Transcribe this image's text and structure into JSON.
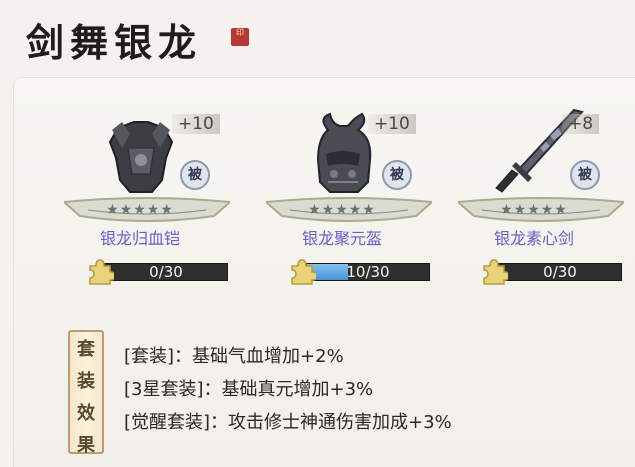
{
  "title": "剑舞银龙",
  "seal_text": "印",
  "items": [
    {
      "name": "银龙归血铠",
      "enhance": "+10",
      "badge": "被",
      "stars": "★★★★★",
      "progress_text": "0/30",
      "progress_fraction": 0.0
    },
    {
      "name": "银龙聚元盔",
      "enhance": "+10",
      "badge": "被",
      "stars": "★★★★★",
      "progress_text": "10/30",
      "progress_fraction": 0.3333
    },
    {
      "name": "银龙素心剑",
      "enhance": "+8",
      "badge": "被",
      "stars": "★★★★★",
      "progress_text": "0/30",
      "progress_fraction": 0.0
    }
  ],
  "set_effect_label": [
    "套",
    "装",
    "效",
    "果"
  ],
  "set_effects": [
    "[套装]：基础气血增加+2%",
    "[3星套装]：基础真元增加+3%",
    "[觉醒套装]：攻击修士神通伤害加成+3%"
  ]
}
